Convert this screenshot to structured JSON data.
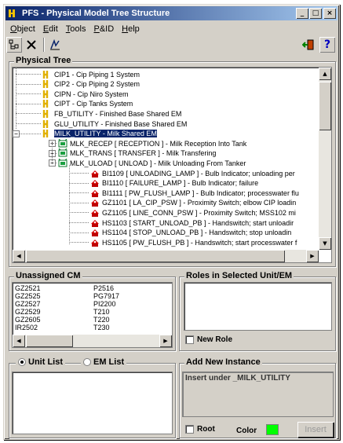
{
  "window": {
    "title": "PFS - Physical Model Tree Structure",
    "controls": [
      "_",
      "□",
      "×"
    ]
  },
  "menu": [
    {
      "label": "Object",
      "accel": "O"
    },
    {
      "label": "Edit",
      "accel": "E"
    },
    {
      "label": "Tools",
      "accel": "T"
    },
    {
      "label": "P&ID",
      "accel": "P"
    },
    {
      "label": "Help",
      "accel": "H"
    }
  ],
  "toolbar": {
    "icons": [
      "tree-new-icon",
      "delete-icon",
      "edit-icon",
      "exit-door-icon",
      "help-icon"
    ]
  },
  "physical_tree": {
    "label": "Physical Tree",
    "rows": [
      {
        "text": "CIP1  - Cip Piping 1 System",
        "icon": "system",
        "indent": 0
      },
      {
        "text": "CIP2  - Cip Piping 2 System",
        "icon": "system",
        "indent": 0
      },
      {
        "text": "CIPN  - Cip Niro System",
        "icon": "system",
        "indent": 0
      },
      {
        "text": "CIPT  - Cip Tanks System",
        "icon": "system",
        "indent": 0
      },
      {
        "text": "FB_UTILITY  - Finished Base Shared EM",
        "icon": "system",
        "indent": 0
      },
      {
        "text": "GLU_UTILITY  - Finished Base Shared EM",
        "icon": "system",
        "indent": 0
      },
      {
        "text": "MILK_UTILITY  - Milk Shared EM",
        "icon": "system",
        "indent": 0,
        "selected": true,
        "expander": "−"
      },
      {
        "text": "MLK_RECEP [ RECEPTION ]  - Milk Reception Into Tank",
        "icon": "unit",
        "indent": 1,
        "expander": "+"
      },
      {
        "text": "MLK_TRANS [ TRANSFER ]  - Milk Transfering",
        "icon": "unit",
        "indent": 1,
        "expander": "+"
      },
      {
        "text": "MLK_ULOAD [ UNLOAD ]  - Milk Unloading From Tanker",
        "icon": "unit",
        "indent": 1,
        "expander": "−"
      },
      {
        "text": "BI1109 [ UNLOADING_LAMP ]  - Bulb Indicator; unloading per",
        "icon": "cm",
        "indent": 2
      },
      {
        "text": "BI1110 [ FAILURE_LAMP ]  - Bulb Indicator; failure",
        "icon": "cm",
        "indent": 2
      },
      {
        "text": "BI1111 [ PW_FLUSH_LAMP ]  - Bulb Indicator; processwater flu",
        "icon": "cm",
        "indent": 2
      },
      {
        "text": "GZ1101 [ LA_CIP_PSW ]  - Proximity Switch; elbow CIP loadin",
        "icon": "cm",
        "indent": 2
      },
      {
        "text": "GZ1105 [ LINE_CONN_PSW ]  - Proximity Switch; MSS102 mi",
        "icon": "cm",
        "indent": 2
      },
      {
        "text": "HS1103 [ START_UNLOAD_PB ]  - Handswitch; start unloadir",
        "icon": "cm",
        "indent": 2
      },
      {
        "text": "HS1104 [ STOP_UNLOAD_PB ]  - Handswitch; stop unloadin",
        "icon": "cm",
        "indent": 2
      },
      {
        "text": "HS1105 [ PW_FLUSH_PB ]  - Handswitch; start processwater f",
        "icon": "cm",
        "indent": 2
      }
    ]
  },
  "unassigned_cm": {
    "label": "Unassigned CM",
    "col1": [
      "GZ2521",
      "GZ2525",
      "GZ2527",
      "GZ2529",
      "GZ2605",
      "IR2502"
    ],
    "col2": [
      "P2516",
      "PG7917",
      "PI2200",
      "T210",
      "T220",
      "T230"
    ]
  },
  "roles": {
    "label": "Roles in Selected Unit/EM",
    "new_role_label": "New Role"
  },
  "list_mode": {
    "unit_list": "Unit List",
    "em_list": "EM List",
    "selected": "unit"
  },
  "add_instance": {
    "label": "Add New Instance",
    "message": "Insert  under _MILK_UTILITY",
    "root_label": "Root",
    "color_label": "Color",
    "color_value": "#00ff00",
    "insert_label": "Insert"
  }
}
